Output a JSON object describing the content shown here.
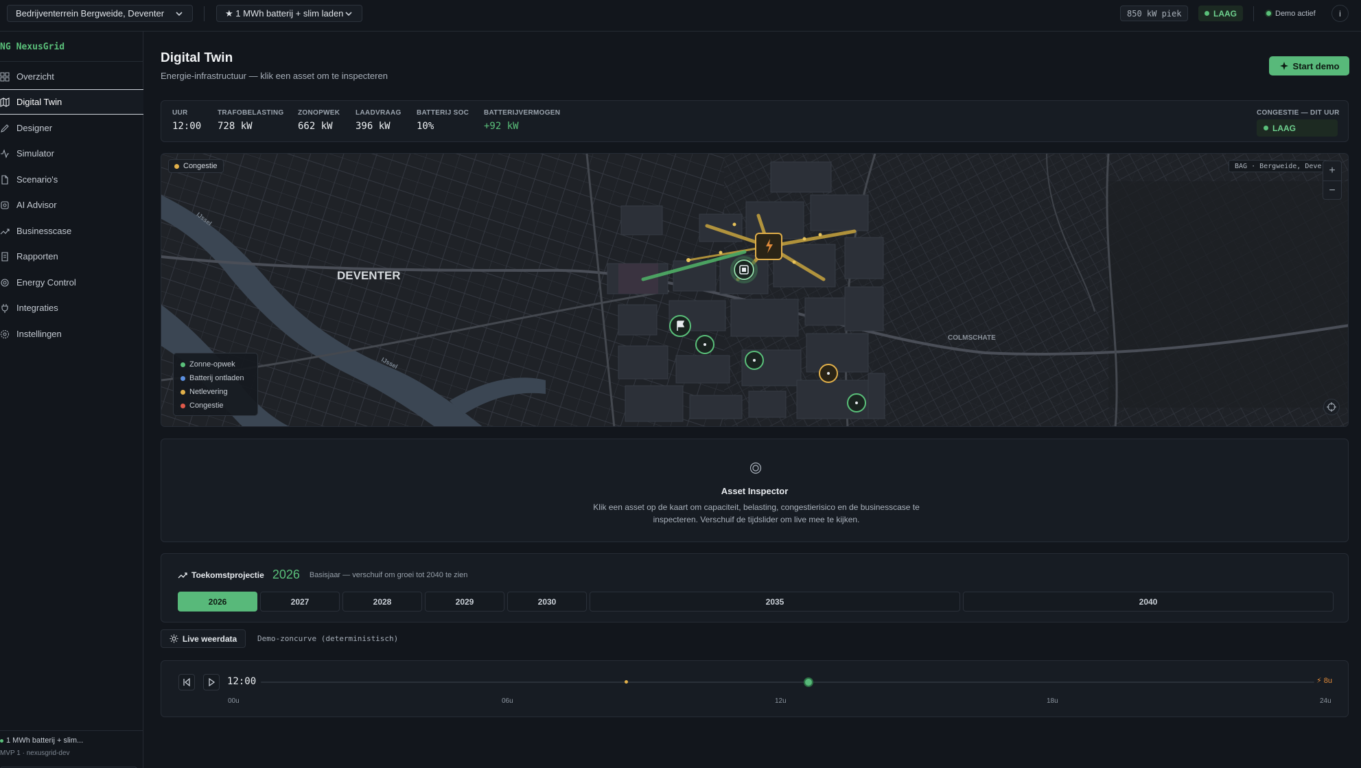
{
  "topbar": {
    "location_select": "Bedrijventerrein Bergweide, Deventer",
    "scenario_select": "★ 1 MWh batterij + slim laden",
    "peak_badge": "850 kW piek",
    "congestion_badge": "LAAG",
    "demo_status": "Demo actief",
    "info_label": "i"
  },
  "sidebar": {
    "brand_badge": "NG",
    "brand_name": "NexusGrid",
    "items": [
      {
        "label": "Overzicht",
        "icon": "grid-icon"
      },
      {
        "label": "Digital Twin",
        "icon": "map-icon",
        "active": true
      },
      {
        "label": "Designer",
        "icon": "pencil-icon"
      },
      {
        "label": "Simulator",
        "icon": "activity-icon"
      },
      {
        "label": "Scenario's",
        "icon": "file-icon"
      },
      {
        "label": "AI Advisor",
        "icon": "ai-icon"
      },
      {
        "label": "Businesscase",
        "icon": "trend-icon"
      },
      {
        "label": "Rapporten",
        "icon": "report-icon"
      },
      {
        "label": "Energy Control",
        "icon": "gear-icon"
      },
      {
        "label": "Integraties",
        "icon": "plug-icon"
      },
      {
        "label": "Instellingen",
        "icon": "settings-icon"
      }
    ],
    "footer_scenario": "1 MWh batterij + slim...",
    "footer_version": "MVP 1 · nexusgrid-dev"
  },
  "page": {
    "title": "Digital Twin",
    "subtitle": "Energie-infrastructuur — klik een asset om te inspecteren",
    "start_demo": "Start demo"
  },
  "metrics": [
    {
      "label": "UUR",
      "value": "12:00"
    },
    {
      "label": "TRAFOBELASTING",
      "value": "728 kW"
    },
    {
      "label": "ZONOPWEK",
      "value": "662 kW"
    },
    {
      "label": "LAADVRAAG",
      "value": "396 kW"
    },
    {
      "label": "BATTERIJ SOC",
      "value": "10%"
    },
    {
      "label": "BATTERIJVERMOGEN",
      "value": "+92 kW"
    }
  ],
  "congestion": {
    "label": "CONGESTIE — DIT UUR",
    "value": "LAAG"
  },
  "map": {
    "tag": "Congestie",
    "source": "BAG · Bergweide, Deve",
    "zoom_in": "+",
    "zoom_out": "−",
    "city_label": "DEVENTER",
    "district_label": "COLMSCHATE",
    "river_label_1": "IJssel",
    "river_label_2": "IJssel",
    "legend": [
      {
        "label": "Zonne-opwek",
        "color": "#5ac07a"
      },
      {
        "label": "Batterij ontladen",
        "color": "#5b8fe0"
      },
      {
        "label": "Netlevering",
        "color": "#e2b04a"
      },
      {
        "label": "Congestie",
        "color": "#e0594a"
      }
    ]
  },
  "inspector": {
    "title": "Asset Inspector",
    "text": "Klik een asset op de kaart om capaciteit, belasting, congestierisico en de businesscase te inspecteren. Verschuif de tijdslider om live mee te kijken."
  },
  "projection": {
    "label": "Toekomstprojectie",
    "year": "2026",
    "hint": "Basisjaar — verschuif om groei tot 2040 te zien",
    "years": [
      "2026",
      "2027",
      "2028",
      "2029",
      "2030",
      "2035",
      "2040"
    ],
    "active_year": "2026"
  },
  "weather": {
    "button": "Live weerdata",
    "source": "Demo-zoncurve (deterministisch)"
  },
  "timeline": {
    "time": "12:00",
    "position_fraction": 0.52,
    "peak_fraction": 0.347,
    "end_label": "8u",
    "ticks": [
      "00u",
      "06u",
      "12u",
      "18u",
      "24u"
    ]
  },
  "colors": {
    "accent": "#58b97a",
    "warning": "#e2b04a",
    "danger": "#e0594a"
  }
}
